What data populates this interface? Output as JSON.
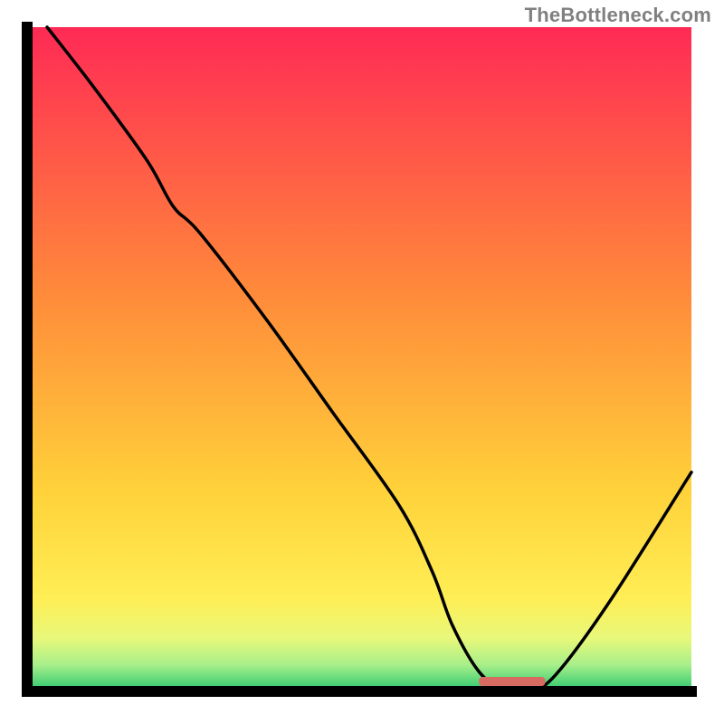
{
  "watermark": {
    "text": "TheBottleneck.com"
  },
  "chart_data": {
    "type": "line",
    "title": "",
    "xlabel": "",
    "ylabel": "",
    "x_range": [
      0,
      100
    ],
    "y_range": [
      0,
      100
    ],
    "series": [
      {
        "name": "curve",
        "x": [
          3,
          10,
          18,
          22,
          26,
          36,
          46,
          56,
          61,
          64,
          68,
          72,
          76,
          80,
          88,
          100
        ],
        "y": [
          100,
          91,
          80,
          73,
          69,
          56,
          42,
          28,
          18,
          10,
          3,
          0,
          0,
          3,
          14,
          33
        ]
      }
    ],
    "optimal_marker": {
      "x_start": 68,
      "x_end": 78,
      "color": "#d86b61"
    },
    "gradient_stops": [
      {
        "offset": 0.0,
        "color": "#ff2a55"
      },
      {
        "offset": 0.4,
        "color": "#ff8a3a"
      },
      {
        "offset": 0.7,
        "color": "#ffd23a"
      },
      {
        "offset": 0.86,
        "color": "#ffee55"
      },
      {
        "offset": 0.92,
        "color": "#e8f87a"
      },
      {
        "offset": 0.96,
        "color": "#a8ef8a"
      },
      {
        "offset": 1.0,
        "color": "#28c76f"
      }
    ]
  }
}
